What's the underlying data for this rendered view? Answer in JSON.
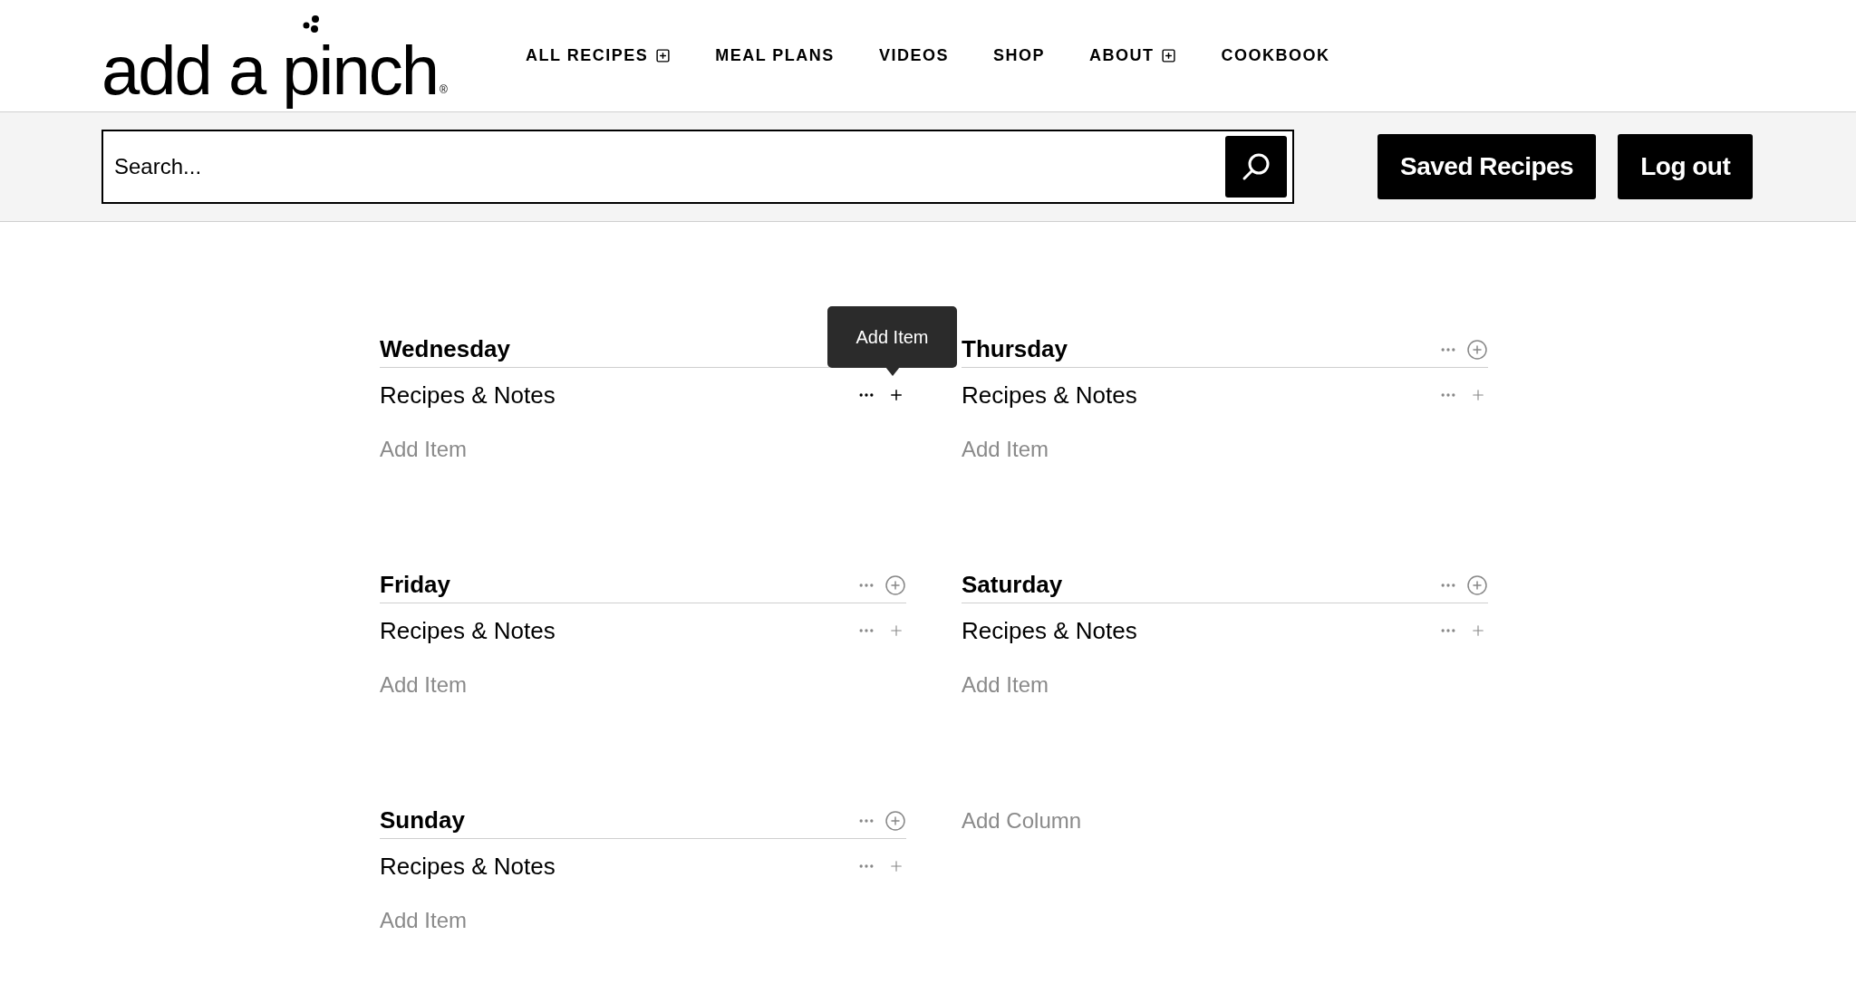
{
  "header": {
    "logo": {
      "text": "add a pinch",
      "mark": "®"
    },
    "nav": [
      {
        "label": "ALL RECIPES",
        "expandable": true
      },
      {
        "label": "MEAL PLANS",
        "expandable": false
      },
      {
        "label": "VIDEOS",
        "expandable": false
      },
      {
        "label": "SHOP",
        "expandable": false
      },
      {
        "label": "ABOUT",
        "expandable": true
      },
      {
        "label": "COOKBOOK",
        "expandable": false
      }
    ]
  },
  "search_bar": {
    "placeholder": "Search...",
    "buttons": [
      "Saved Recipes",
      "Log out"
    ]
  },
  "days": [
    {
      "title": "Wednesday",
      "section": "Recipes & Notes",
      "add_item": "Add Item",
      "tooltip": "Add Item",
      "hovered": true
    },
    {
      "title": "Thursday",
      "section": "Recipes & Notes",
      "add_item": "Add Item",
      "hovered": false
    },
    {
      "title": "Friday",
      "section": "Recipes & Notes",
      "add_item": "Add Item",
      "hovered": false
    },
    {
      "title": "Saturday",
      "section": "Recipes & Notes",
      "add_item": "Add Item",
      "hovered": false
    },
    {
      "title": "Sunday",
      "section": "Recipes & Notes",
      "add_item": "Add Item",
      "hovered": false
    }
  ],
  "add_column": "Add Column"
}
